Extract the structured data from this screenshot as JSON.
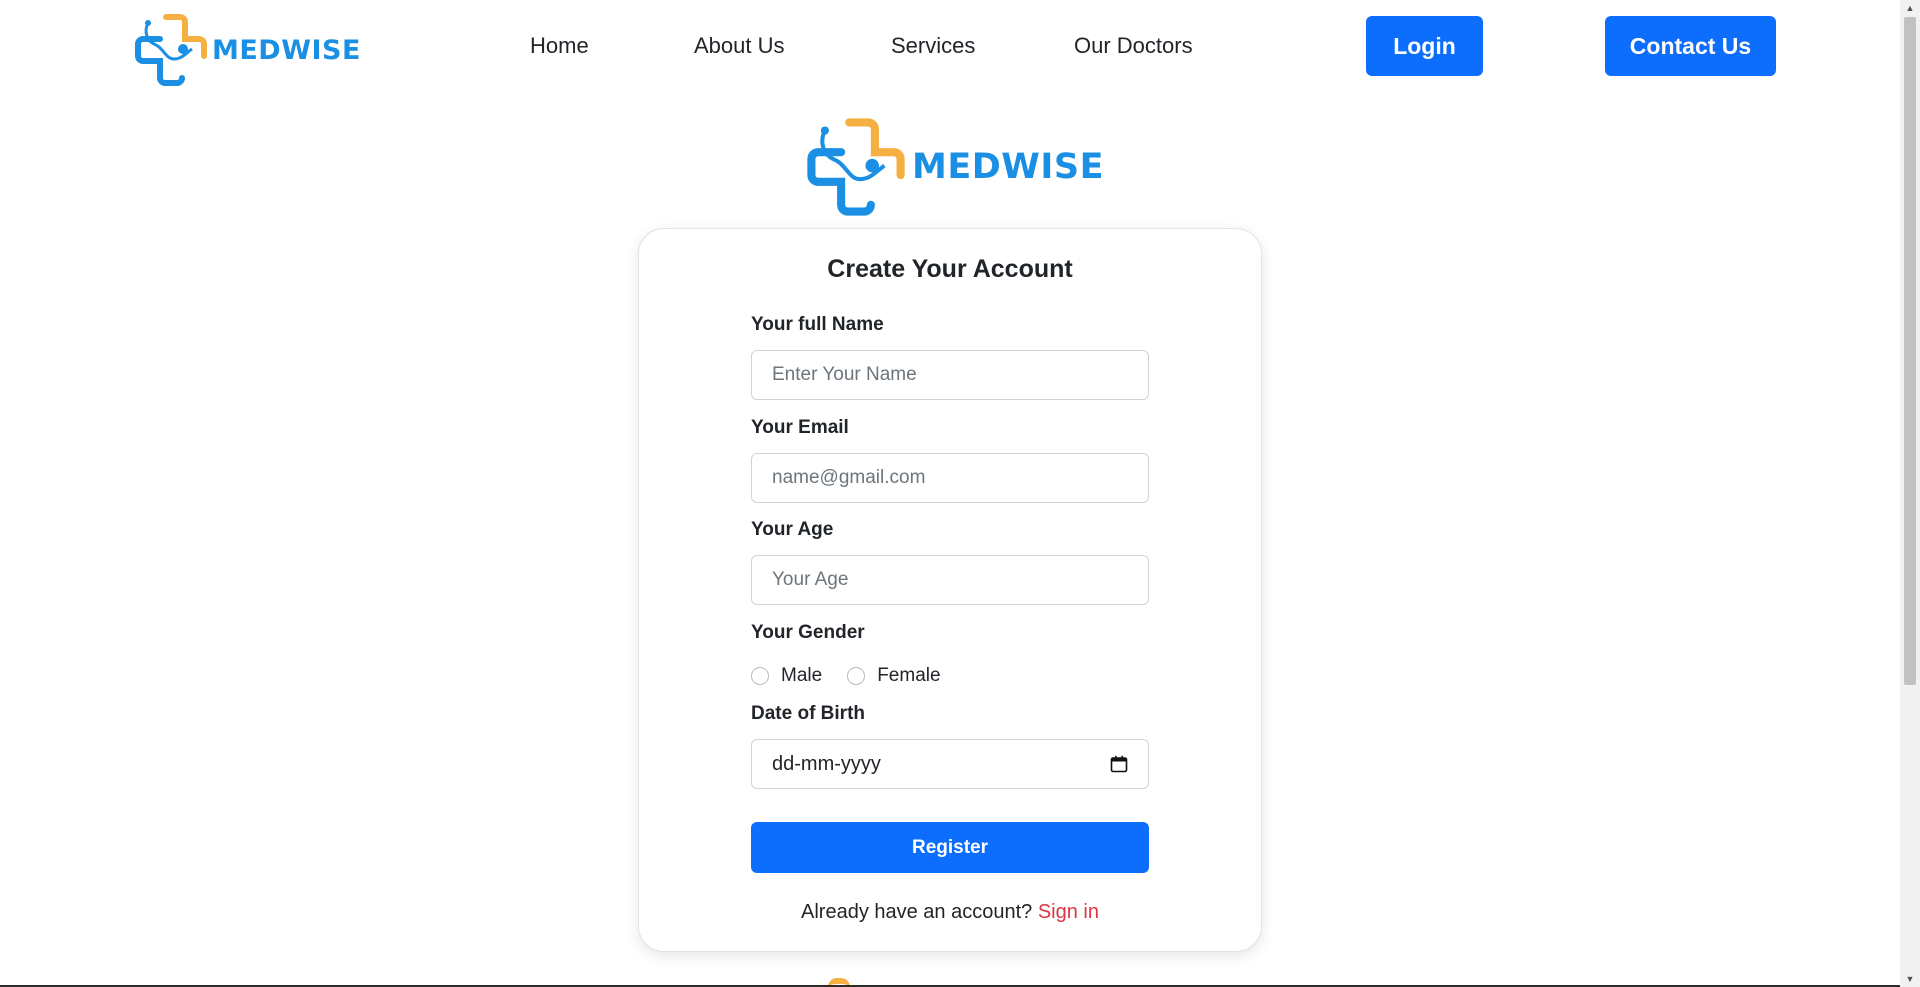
{
  "brand": {
    "name": "MEDWISE",
    "colors": {
      "primary_blue": "#1a8fe3",
      "accent_orange": "#f5b041"
    }
  },
  "nav": {
    "links": [
      "Home",
      "About Us",
      "Services",
      "Our Doctors"
    ],
    "login_label": "Login",
    "contact_label": "Contact Us"
  },
  "form": {
    "title": "Create Your Account",
    "name_label": "Your full Name",
    "name_placeholder": "Enter Your Name",
    "email_label": "Your Email",
    "email_placeholder": "name@gmail.com",
    "age_label": "Your Age",
    "age_placeholder": "Your Age",
    "gender_label": "Your Gender",
    "gender_options": [
      "Male",
      "Female"
    ],
    "dob_label": "Date of Birth",
    "dob_placeholder": "dd-mm-yyyy",
    "register_label": "Register",
    "signin_prompt": "Already have an account?",
    "signin_link": "Sign in"
  },
  "colors": {
    "button_blue": "#0d6efd",
    "link_red": "#dc3545"
  }
}
